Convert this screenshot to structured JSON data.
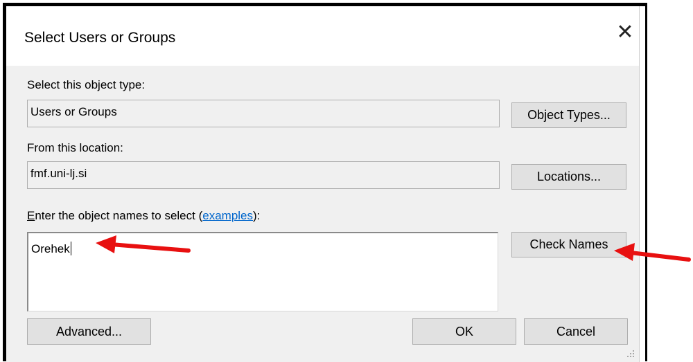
{
  "dialog": {
    "title": "Select Users or Groups",
    "close_glyph": "✕"
  },
  "object_type": {
    "label": "Select this object type:",
    "value": "Users or Groups",
    "button_label": "Object Types..."
  },
  "location": {
    "label": "From this location:",
    "value": "fmf.uni-lj.si",
    "button_label": "Locations..."
  },
  "names": {
    "label_accel": "E",
    "label_rest": "nter the object names to select (",
    "label_link": "examples",
    "label_suffix": "):",
    "value": "Orehek",
    "button_label": "Check Names"
  },
  "footer": {
    "advanced_label": "Advanced...",
    "ok_label": "OK",
    "cancel_label": "Cancel"
  },
  "annotations": {
    "arrow_color": "#e81010",
    "arrows": [
      "pointing-to-names-input",
      "pointing-to-check-names-button"
    ]
  }
}
